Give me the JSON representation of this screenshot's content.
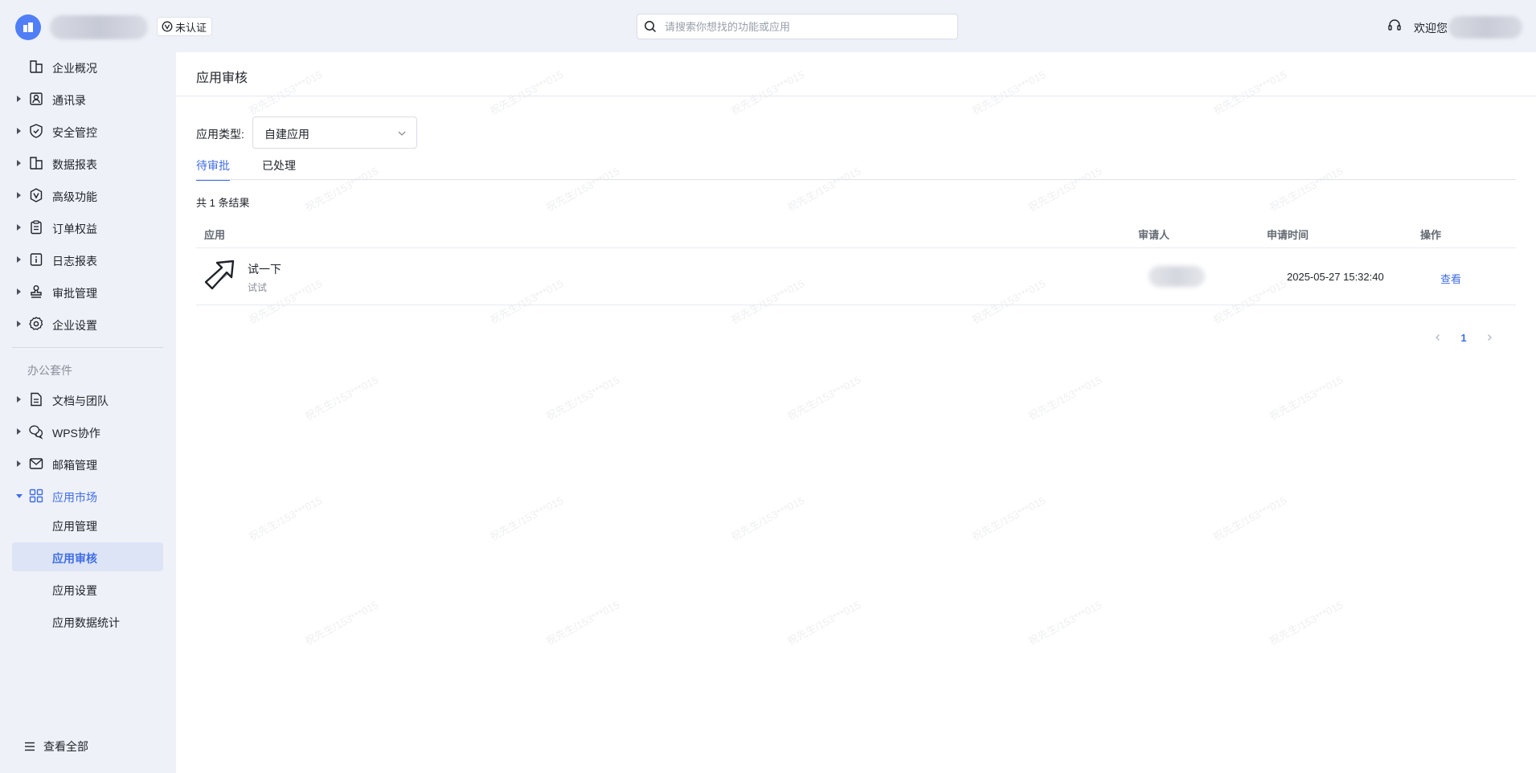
{
  "header": {
    "cert_label": "未认证",
    "search_placeholder": "请搜索你想找的功能或应用",
    "welcome": "欢迎您"
  },
  "sidebar": {
    "items": [
      {
        "label": "企业概况",
        "icon": "building-icon"
      },
      {
        "label": "通讯录",
        "icon": "contacts-icon"
      },
      {
        "label": "安全管控",
        "icon": "shield-icon"
      },
      {
        "label": "数据报表",
        "icon": "report-icon"
      },
      {
        "label": "高级功能",
        "icon": "advanced-badge-icon"
      },
      {
        "label": "订单权益",
        "icon": "clipboard-icon"
      },
      {
        "label": "日志报表",
        "icon": "log-icon"
      },
      {
        "label": "审批管理",
        "icon": "stamp-icon"
      },
      {
        "label": "企业设置",
        "icon": "gear-icon"
      }
    ],
    "section_title": "办公套件",
    "suite_items": [
      {
        "label": "文档与团队",
        "icon": "document-icon"
      },
      {
        "label": "WPS协作",
        "icon": "chat-icon"
      },
      {
        "label": "邮箱管理",
        "icon": "mail-icon"
      },
      {
        "label": "应用市场",
        "icon": "grid-icon"
      }
    ],
    "sub_items": [
      {
        "label": "应用管理"
      },
      {
        "label": "应用审核"
      },
      {
        "label": "应用设置"
      },
      {
        "label": "应用数据统计"
      }
    ],
    "view_all": "查看全部"
  },
  "main": {
    "title": "应用审核",
    "filter_label": "应用类型:",
    "filter_value": "自建应用",
    "tabs": [
      {
        "label": "待审批"
      },
      {
        "label": "已处理"
      }
    ],
    "result_count": "共 1 条结果",
    "columns": [
      "应用",
      "审请人",
      "申请时间",
      "操作"
    ],
    "rows": [
      {
        "app_name": "试一下",
        "app_desc": "试试",
        "apply_time": "2025-05-27 15:32:40",
        "action": "查看"
      }
    ],
    "pagination": {
      "current": "1"
    }
  },
  "watermark": "祝先生/153***015",
  "colors": {
    "accent": "#3f6de6",
    "logo": "#4f7ef7"
  }
}
